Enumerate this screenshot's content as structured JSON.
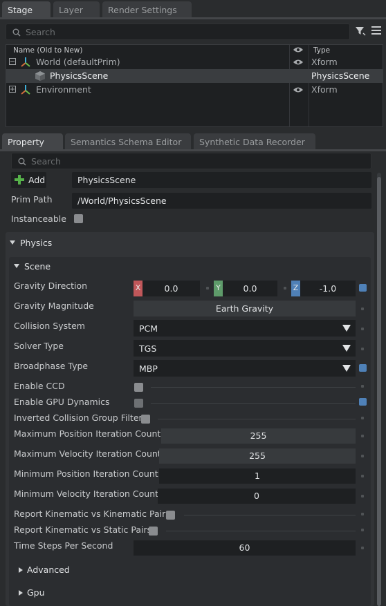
{
  "stage_panel": {
    "tabs": [
      "Stage",
      "Layer",
      "Render Settings"
    ],
    "search_placeholder": "Search",
    "columns": {
      "name": "Name (Old to New)",
      "type": "Type"
    },
    "rows": [
      {
        "name": "World (defaultPrim)",
        "type": "Xform",
        "icon": "xform-icon"
      },
      {
        "name": "PhysicsScene",
        "type": "PhysicsScene",
        "icon": "cube-icon"
      },
      {
        "name": "Environment",
        "type": "Xform",
        "icon": "xform-icon"
      }
    ]
  },
  "property_panel": {
    "tabs": [
      "Property",
      "Semantics Schema Editor",
      "Synthetic Data Recorder"
    ],
    "search_placeholder": "Search",
    "add_label": "Add",
    "prim_name": "PhysicsScene",
    "prim_path_label": "Prim Path",
    "prim_path": "/World/PhysicsScene",
    "instanceable_label": "Instanceable",
    "physics_title": "Physics",
    "scene_title": "Scene",
    "fields": {
      "gravity_direction": {
        "label": "Gravity Direction",
        "x": "0.0",
        "y": "0.0",
        "z": "-1.0",
        "x_axis": "X",
        "y_axis": "Y",
        "z_axis": "Z"
      },
      "gravity_magnitude": {
        "label": "Gravity Magnitude",
        "value": "Earth Gravity"
      },
      "collision_system": {
        "label": "Collision System",
        "value": "PCM"
      },
      "solver_type": {
        "label": "Solver Type",
        "value": "TGS"
      },
      "broadphase_type": {
        "label": "Broadphase Type",
        "value": "MBP"
      },
      "enable_ccd": {
        "label": "Enable CCD"
      },
      "enable_gpu_dynamics": {
        "label": "Enable GPU Dynamics"
      },
      "inverted_collision": {
        "label": "Inverted Collision Group Filter"
      },
      "max_pos_iter": {
        "label": "Maximum Position Iteration Count",
        "value": "255"
      },
      "max_vel_iter": {
        "label": "Maximum Velocity Iteration Count",
        "value": "255"
      },
      "min_pos_iter": {
        "label": "Minimum Position Iteration Count",
        "value": "1"
      },
      "min_vel_iter": {
        "label": "Minimum Velocity Iteration Count",
        "value": "0"
      },
      "report_kin_kin": {
        "label": "Report Kinematic vs Kinematic Pairs"
      },
      "report_kin_static": {
        "label": "Report Kinematic vs Static Pairs"
      },
      "time_steps": {
        "label": "Time Steps Per Second",
        "value": "60"
      }
    },
    "advanced_title": "Advanced",
    "gpu_title": "Gpu"
  },
  "colors": {
    "accent_blue": "#4f81b8",
    "axis_x": "#c0575a",
    "axis_y": "#5e9b6a",
    "axis_z": "#4f80b6",
    "selected_row": "#3a3d40"
  }
}
